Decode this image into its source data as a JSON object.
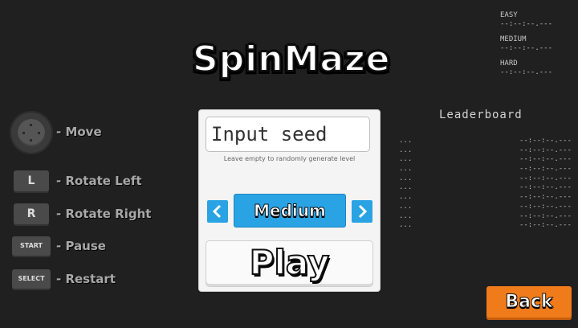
{
  "title": "SpinMaze",
  "best_times": [
    {
      "label": "EASY",
      "value": "--:--:--.---"
    },
    {
      "label": "MEDIUM",
      "value": "--:--:--.---"
    },
    {
      "label": "HARD",
      "value": "--:--:--.---"
    }
  ],
  "controls": [
    {
      "key": "",
      "icon": "joystick-icon",
      "label": "- Move"
    },
    {
      "key": "L",
      "label": "- Rotate Left"
    },
    {
      "key": "R",
      "label": "- Rotate Right"
    },
    {
      "key": "START",
      "label": "- Pause"
    },
    {
      "key": "SELECT",
      "label": "- Restart"
    }
  ],
  "panel": {
    "seed_placeholder": "Input seed",
    "seed_value": "",
    "hint": "Leave empty to randomly generate level",
    "difficulty": "Medium",
    "prev_icon": "chevron-left-icon",
    "next_icon": "chevron-right-icon",
    "play_label": "Play"
  },
  "leaderboard": {
    "title": "Leaderboard",
    "entries": [
      {
        "name": "...",
        "time": "--:--:--.---"
      },
      {
        "name": "...",
        "time": "--:--:--.---"
      },
      {
        "name": "...",
        "time": "--:--:--.---"
      },
      {
        "name": "...",
        "time": "--:--:--.---"
      },
      {
        "name": "...",
        "time": "--:--:--.---"
      },
      {
        "name": "...",
        "time": "--:--:--.---"
      },
      {
        "name": "...",
        "time": "--:--:--.---"
      },
      {
        "name": "...",
        "time": "--:--:--.---"
      },
      {
        "name": "...",
        "time": "--:--:--.---"
      },
      {
        "name": "...",
        "time": "--:--:--.---"
      }
    ]
  },
  "back_label": "Back",
  "colors": {
    "accent_blue": "#2aa3e4",
    "back_orange": "#f07b1a",
    "background": "#202020"
  }
}
